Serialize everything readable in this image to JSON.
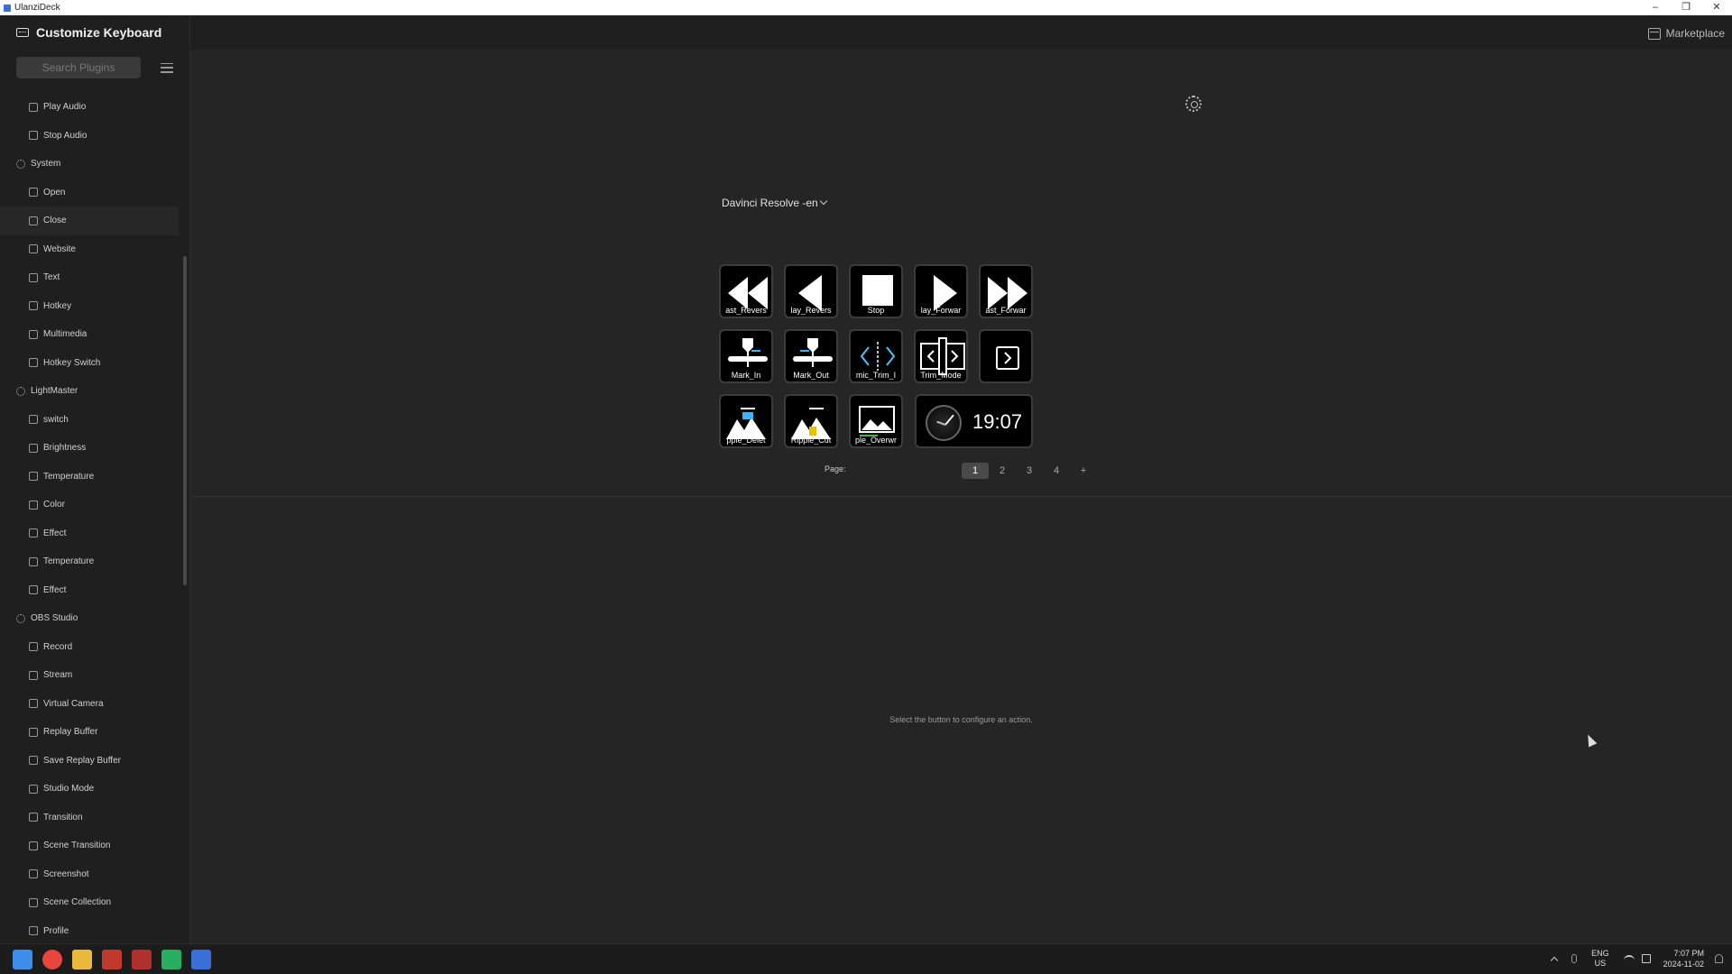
{
  "window": {
    "title": "UlanziDeck",
    "controls": [
      "–",
      "❐",
      "✕"
    ]
  },
  "sidebar": {
    "header": "Customize Keyboard",
    "search_placeholder": "Search Plugins",
    "items": [
      {
        "label": "Play Audio",
        "kind": "child",
        "icon": "play-audio-icon"
      },
      {
        "label": "Stop Audio",
        "kind": "child",
        "icon": "stop-audio-icon"
      },
      {
        "label": "System",
        "kind": "group",
        "icon": "system-gear-icon"
      },
      {
        "label": "Open",
        "kind": "child",
        "icon": "open-icon"
      },
      {
        "label": "Close",
        "kind": "child",
        "icon": "close-icon",
        "active": true
      },
      {
        "label": "Website",
        "kind": "child",
        "icon": "globe-icon"
      },
      {
        "label": "Text",
        "kind": "child",
        "icon": "text-icon"
      },
      {
        "label": "Hotkey",
        "kind": "child",
        "icon": "keyboard-icon"
      },
      {
        "label": "Multimedia",
        "kind": "child",
        "icon": "multimedia-icon"
      },
      {
        "label": "Hotkey Switch",
        "kind": "child",
        "icon": "hotkey-switch-icon"
      },
      {
        "label": "LightMaster",
        "kind": "group",
        "icon": "lightbulb-icon"
      },
      {
        "label": "switch",
        "kind": "child",
        "icon": "power-icon"
      },
      {
        "label": "Brightness",
        "kind": "child",
        "icon": "brightness-icon"
      },
      {
        "label": "Temperature",
        "kind": "child",
        "icon": "temperature-icon"
      },
      {
        "label": "Color",
        "kind": "child",
        "icon": "color-icon"
      },
      {
        "label": "Effect",
        "kind": "child",
        "icon": "effect-icon"
      },
      {
        "label": "Temperature",
        "kind": "child",
        "icon": "temperature-icon"
      },
      {
        "label": "Effect",
        "kind": "child",
        "icon": "effect-icon"
      },
      {
        "label": "OBS Studio",
        "kind": "group",
        "icon": "obs-icon"
      },
      {
        "label": "Record",
        "kind": "child",
        "icon": "record-icon"
      },
      {
        "label": "Stream",
        "kind": "child",
        "icon": "stream-icon"
      },
      {
        "label": "Virtual Camera",
        "kind": "child",
        "icon": "camera-icon"
      },
      {
        "label": "Replay Buffer",
        "kind": "child",
        "icon": "replay-icon"
      },
      {
        "label": "Save Replay Buffer",
        "kind": "child",
        "icon": "save-replay-icon"
      },
      {
        "label": "Studio Mode",
        "kind": "child",
        "icon": "studio-mode-icon"
      },
      {
        "label": "Transition",
        "kind": "child",
        "icon": "transition-icon"
      },
      {
        "label": "Scene Transition",
        "kind": "child",
        "icon": "scene-transition-icon"
      },
      {
        "label": "Screenshot",
        "kind": "child",
        "icon": "screenshot-icon"
      },
      {
        "label": "Scene Collection",
        "kind": "child",
        "icon": "scene-collection-icon"
      },
      {
        "label": "Profile",
        "kind": "child",
        "icon": "profile-icon"
      }
    ]
  },
  "topbar": {
    "marketplace": "Marketplace"
  },
  "profile": {
    "name": "Davinci Resolve -en"
  },
  "keys": [
    {
      "label": "ast_Revers",
      "icon": "fast-reverse-icon"
    },
    {
      "label": "lay_Revers",
      "icon": "play-reverse-icon"
    },
    {
      "label": "Stop",
      "icon": "stop-icon"
    },
    {
      "label": "lay_Forwar",
      "icon": "play-forward-icon"
    },
    {
      "label": "ast_Forwar",
      "icon": "fast-forward-icon"
    },
    {
      "label": "Mark_In",
      "icon": "mark-in-icon"
    },
    {
      "label": "Mark_Out",
      "icon": "mark-out-icon"
    },
    {
      "label": "mic_Trim_I",
      "icon": "dynamic-trim-icon"
    },
    {
      "label": "Trim_Mode",
      "icon": "trim-mode-icon"
    },
    {
      "label": "",
      "icon": "folder-open-icon"
    },
    {
      "label": "pple_Delet",
      "icon": "ripple-delete-icon"
    },
    {
      "label": "Ripple_Cut",
      "icon": "ripple-cut-icon"
    },
    {
      "label": "ple_Overwr",
      "icon": "ripple-overwrite-icon"
    }
  ],
  "clock": {
    "time": "19:07",
    "icon": "clock-icon"
  },
  "pager": {
    "label": "Page:",
    "pages": [
      "1",
      "2",
      "3",
      "4",
      "+"
    ],
    "active": "1"
  },
  "hint": "Select the button to configure an action.",
  "taskbar": {
    "apps": [
      "windows-start-icon",
      "chrome-icon",
      "file-explorer-icon",
      "app-red-icon",
      "app-media-icon",
      "app-green-icon",
      "ulanzideck-icon"
    ],
    "lang_top": "ENG",
    "lang_bottom": "US",
    "time": "7:07 PM",
    "date": "2024-11-02"
  }
}
